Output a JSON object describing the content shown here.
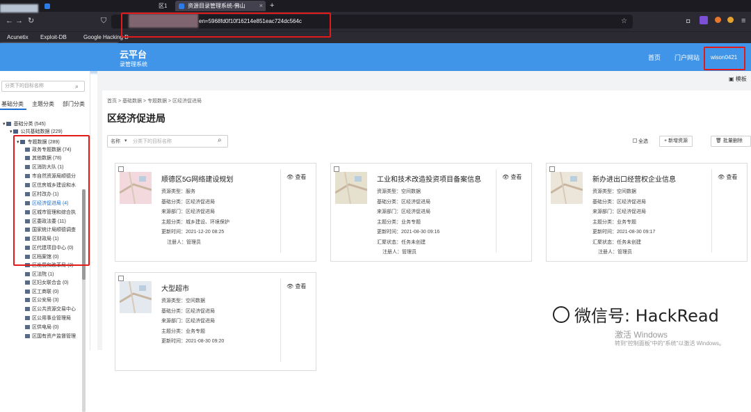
{
  "browser": {
    "tab_inactive": "区1",
    "tab_active": "资源目录管理系统-佛山",
    "url": "en=5968fd0f10f16214e851eac724dc564c",
    "bookmarks": [
      "Acunetix",
      "Exploit-DB",
      "Google Hacking D"
    ],
    "new_tab": "+",
    "close_tab": "×"
  },
  "header": {
    "title_line1": "云平台",
    "title_line2": "录管理系统",
    "nav_home": "首页",
    "nav_portal": "门户网站",
    "username": "wison0421"
  },
  "sidebar": {
    "search_placeholder": "分类下的目标名称",
    "tabs": [
      "基础分类",
      "主题分类",
      "部门分类"
    ],
    "tree": [
      {
        "label": "基础分类 (545)",
        "level": 0
      },
      {
        "label": "公共基础数据 (229)",
        "level": 1
      },
      {
        "label": "专题数据 (289)",
        "level": 1
      },
      {
        "label": "政务专题数据 (74)",
        "level": 2
      },
      {
        "label": "其他数据 (78)",
        "level": 2
      },
      {
        "label": "区消防大队 (1)",
        "level": 2
      },
      {
        "label": "市自然资源局顺德分",
        "level": 2
      },
      {
        "label": "区住房城乡建设和水",
        "level": 2
      },
      {
        "label": "区村改办 (1)",
        "level": 2
      },
      {
        "label": "区经济促进局 (4)",
        "level": 2,
        "selected": true
      },
      {
        "label": "区城市管理和综合执",
        "level": 2
      },
      {
        "label": "区委政法委 (11)",
        "level": 2
      },
      {
        "label": "国家统计局顺德调查",
        "level": 2
      },
      {
        "label": "区财政局 (1)",
        "level": 2
      },
      {
        "label": "区代建项目中心 (0)",
        "level": 2
      },
      {
        "label": "区档案馆 (0)",
        "level": 2
      },
      {
        "label": "区发展和改革局 (3)",
        "level": 2
      },
      {
        "label": "区法院 (1)",
        "level": 2
      },
      {
        "label": "区妇女联合会 (0)",
        "level": 2
      },
      {
        "label": "区工商联 (0)",
        "level": 2
      },
      {
        "label": "区公安局 (3)",
        "level": 2
      },
      {
        "label": "区公共资源交易中心",
        "level": 2
      },
      {
        "label": "区公用事业管理局",
        "level": 2
      },
      {
        "label": "区供电局 (0)",
        "level": 2
      },
      {
        "label": "区国有资产监督管理",
        "level": 2
      }
    ]
  },
  "main": {
    "template_label": "模板",
    "breadcrumb": [
      "首页",
      "基础数据",
      "专题数据",
      "区经济促进局"
    ],
    "page_title": "区经济促进局",
    "filter_select": "名称",
    "filter_placeholder": "分类下的目标名称",
    "select_all": "全选",
    "add_button": "+ 新增资源",
    "batch_delete": "批量删除",
    "view_label": "查看",
    "cards": [
      {
        "title": "顺德区5G网络建设规划",
        "lines": [
          "资源类型：服务",
          "基础分类：区经济促进局",
          "来源部门：区经济促进局",
          "主题分类：城乡建设、环境保护",
          "更新时间：2021-12-20 08:25",
          "注册人：管理员"
        ]
      },
      {
        "title": "工业和技术改造投资项目备案信息",
        "lines": [
          "资源类型：空间数据",
          "基础分类：区经济促进局",
          "来源部门：区经济促进局",
          "主题分类：业务专题",
          "更新时间：2021-08-30 09:16",
          "汇聚状态：任务未创建",
          "注册人：管理员"
        ]
      },
      {
        "title": "新办进出口经营权企业信息",
        "lines": [
          "资源类型：空间数据",
          "基础分类：区经济促进局",
          "来源部门：区经济促进局",
          "主题分类：业务专题",
          "更新时间：2021-08-30 09:17",
          "汇聚状态：任务未创建",
          "注册人：管理员"
        ]
      },
      {
        "title": "大型超市",
        "lines": [
          "资源类型：空间数据",
          "基础分类：区经济促进局",
          "来源部门：区经济促进局",
          "主题分类：业务专题",
          "更新时间：2021-08-30 09:20"
        ]
      }
    ]
  },
  "overlay": {
    "windows_line1": "激活 Windows",
    "windows_line2": "转到\"控制面板\"中的\"系统\"以激活 Windows。",
    "watermark": "微信号: HackRead"
  },
  "colors": {
    "header_blue": "#4095e8",
    "highlight_red": "#e41919",
    "link_blue": "#1a6fd1"
  }
}
